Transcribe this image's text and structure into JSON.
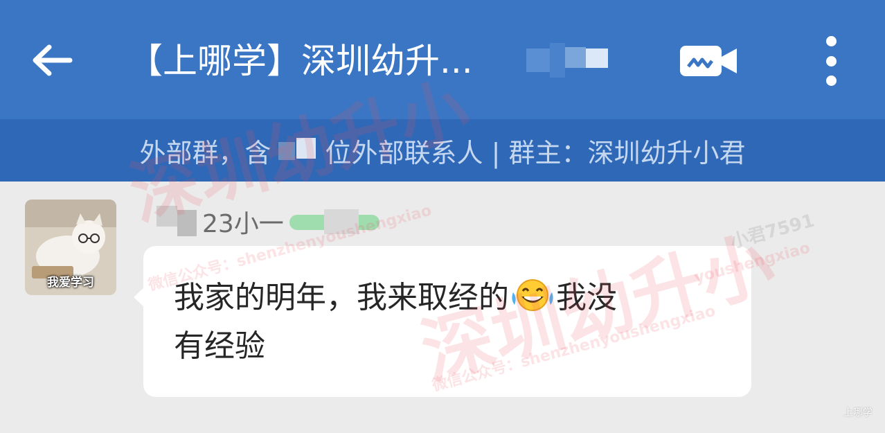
{
  "header": {
    "title": "【上哪学】深圳幼升...",
    "back_icon": "arrow-left-icon",
    "video_icon": "video-call-icon",
    "more_icon": "more-vertical-icon",
    "background_color": "#3a76c4"
  },
  "subbar": {
    "prefix": "外部群，含",
    "suffix": "位外部联系人 | 群主：深圳幼升小君",
    "background_color": "#2f68b6"
  },
  "message": {
    "avatar_caption": "我爱学习",
    "sender_name": "23小一",
    "line1_before_emoji": "我家的明年，我来取经的",
    "emoji": "tears-of-joy-emoji",
    "line1_after_emoji": "我没",
    "line2": "有经验"
  },
  "watermark": {
    "big_text_a": "深圳幼升小",
    "big_text_b": "深圳幼升小",
    "small_text_a": "微信公众号：shenzhenyoushengxiao",
    "small_text_b": "微信公众号：shenzhenyoushengxiao",
    "small_text_c": "小君7591",
    "small_text_d": "youshengxiao",
    "corner_mark": "上哪学"
  }
}
